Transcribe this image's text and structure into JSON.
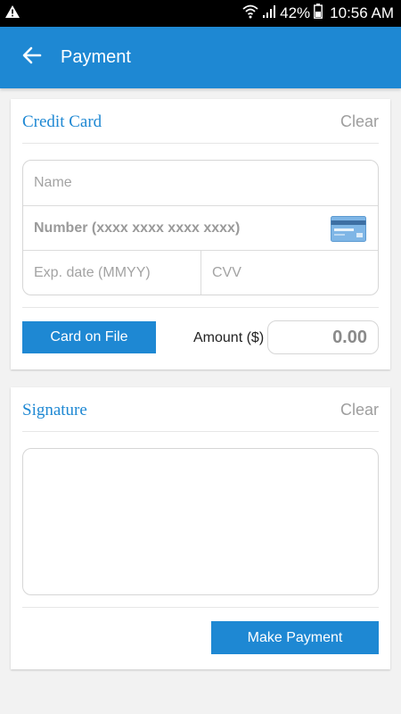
{
  "status_bar": {
    "alert_icon": "warning-triangle-icon",
    "wifi_icon": "wifi-icon",
    "signal_icon": "signal-bars-icon",
    "battery_icon": "battery-icon",
    "battery_percent": "42%",
    "time": "10:56 AM"
  },
  "app_bar": {
    "back_icon": "arrow-left-icon",
    "title": "Payment",
    "color": "#1e88d3"
  },
  "credit_card": {
    "title": "Credit Card",
    "clear_label": "Clear",
    "name_placeholder": "Name",
    "number_placeholder": "Number (xxxx xxxx xxxx xxxx)",
    "card_icon": "credit-card-icon",
    "exp_placeholder": "Exp. date (MMYY)",
    "cvv_placeholder": "CVV",
    "card_on_file_label": "Card on File",
    "amount_label": "Amount ($)",
    "amount_value": "0.00"
  },
  "signature": {
    "title": "Signature",
    "clear_label": "Clear",
    "make_payment_label": "Make Payment"
  }
}
